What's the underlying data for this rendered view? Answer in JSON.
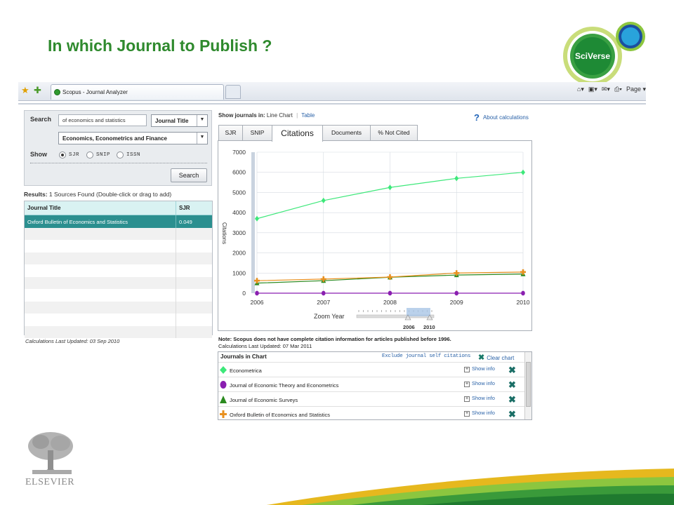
{
  "slide": {
    "title": "In which Journal to Publish ?",
    "sciverse_label": "SciVerse",
    "elsevier_label": "ELSEVIER"
  },
  "browser": {
    "tab_title": "Scopus - Journal Analyzer",
    "page_label": "Page"
  },
  "search": {
    "search_label": "Search",
    "query_value": "of economics and statistics",
    "field_select": "Journal Title",
    "subject_select": "Economics, Econometrics and Finance",
    "show_label": "Show",
    "show_options": [
      "SJR",
      "SNIP",
      "ISSN"
    ],
    "show_selected": "SJR",
    "button_label": "Search"
  },
  "results": {
    "prefix": "Results:",
    "text": "1 Sources Found (Double-click or drag to add)",
    "columns": [
      "Journal Title",
      "SJR"
    ],
    "rows": [
      {
        "title": "Oxford Bulletin of Economics and Statistics",
        "sjr": "0.049",
        "selected": true
      }
    ],
    "calc_updated": "Calculations Last Updated: 03 Sep 2010"
  },
  "view": {
    "show_prefix": "Show journals in:",
    "line_chart": "Line Chart",
    "table": "Table",
    "about": "About calculations"
  },
  "tabs": [
    {
      "label": "SJR",
      "active": false
    },
    {
      "label": "SNIP",
      "active": false
    },
    {
      "label": "Citations",
      "active": true
    },
    {
      "label": "Documents",
      "active": false
    },
    {
      "label": "% Not Cited",
      "active": false
    }
  ],
  "zoom": {
    "label": "Zoom Year",
    "from": "2006",
    "to": "2010"
  },
  "chart_data": {
    "type": "line",
    "ylabel": "Citations",
    "xlabel": "",
    "x": [
      2006,
      2007,
      2008,
      2009,
      2010
    ],
    "x_tick_labels": [
      "2006",
      "2007",
      "2008",
      "2009",
      "2010"
    ],
    "y_tick_labels": [
      "0",
      "1000",
      "2000",
      "3000",
      "4000",
      "5000",
      "6000",
      "7000"
    ],
    "ylim": [
      0,
      7000
    ],
    "grid": true,
    "series": [
      {
        "name": "Econometrica",
        "color": "#3de87a",
        "marker": "diamond",
        "values": [
          3700,
          4600,
          5250,
          5700,
          6000
        ]
      },
      {
        "name": "Journal of Economic Theory and Econometrics",
        "color": "#8a1fb0",
        "marker": "circle",
        "values": [
          0,
          0,
          0,
          0,
          0
        ]
      },
      {
        "name": "Journal of Economic Surveys",
        "color": "#2b8a1f",
        "marker": "triangle",
        "values": [
          500,
          620,
          790,
          900,
          950
        ]
      },
      {
        "name": "Oxford Bulletin of Economics and Statistics",
        "color": "#e8901f",
        "marker": "plus",
        "values": [
          620,
          700,
          800,
          1000,
          1050
        ]
      }
    ]
  },
  "notes": {
    "line1": "Note: Scopus does not have complete citation information for articles published before 1996.",
    "line2": "Calculations Last Updated: 07 Mar 2011"
  },
  "journals_in_chart": {
    "title": "Journals in Chart",
    "exclude_label": "Exclude journal self citations",
    "clear_label": "Clear chart",
    "show_info_label": "Show info",
    "items": [
      {
        "name": "Econometrica",
        "color": "#3de87a",
        "marker": "diamond"
      },
      {
        "name": "Journal of Economic Theory and Econometrics",
        "color": "#8a1fb0",
        "marker": "circle"
      },
      {
        "name": "Journal of Economic Surveys",
        "color": "#2b8a1f",
        "marker": "triangle"
      },
      {
        "name": "Oxford Bulletin of Economics and Statistics",
        "color": "#e8901f",
        "marker": "plus"
      }
    ]
  }
}
